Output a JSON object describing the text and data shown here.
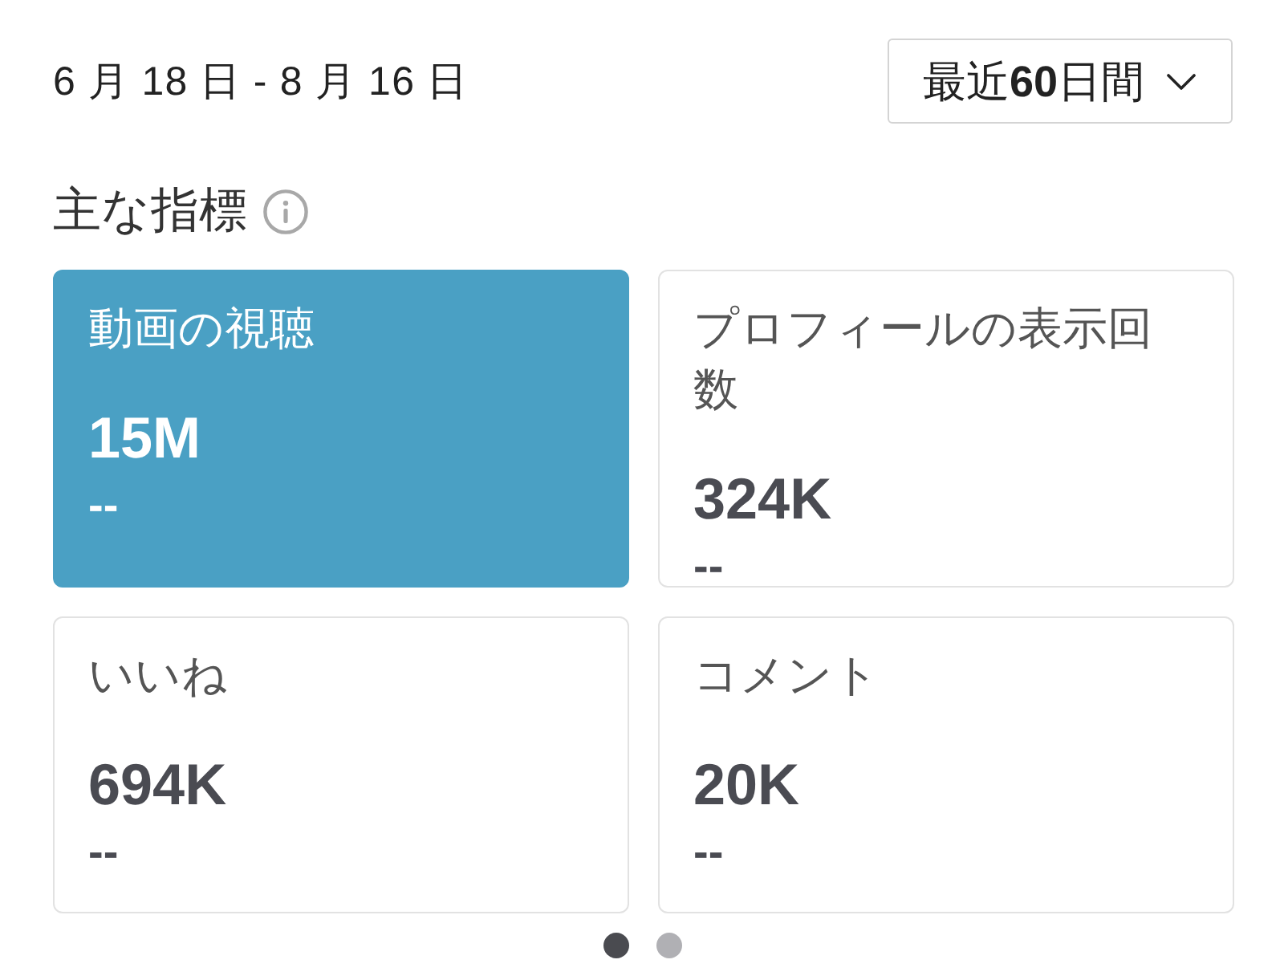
{
  "date_range": "6 月 18 日 - 8 月 16 日",
  "period_dropdown": {
    "label": "最近**60**日間"
  },
  "section": {
    "title": "主な指標"
  },
  "metrics": [
    {
      "label": "動画の視聴",
      "value": "15M",
      "change": "--",
      "selected": true
    },
    {
      "label": "プロフィールの表示回数",
      "value": "324K",
      "change": "--",
      "selected": false
    },
    {
      "label": "いいね",
      "value": "694K",
      "change": "--",
      "selected": false
    },
    {
      "label": "コメント",
      "value": "20K",
      "change": "--",
      "selected": false
    }
  ],
  "pager": [
    {
      "selected": true
    },
    {
      "selected": false
    }
  ]
}
